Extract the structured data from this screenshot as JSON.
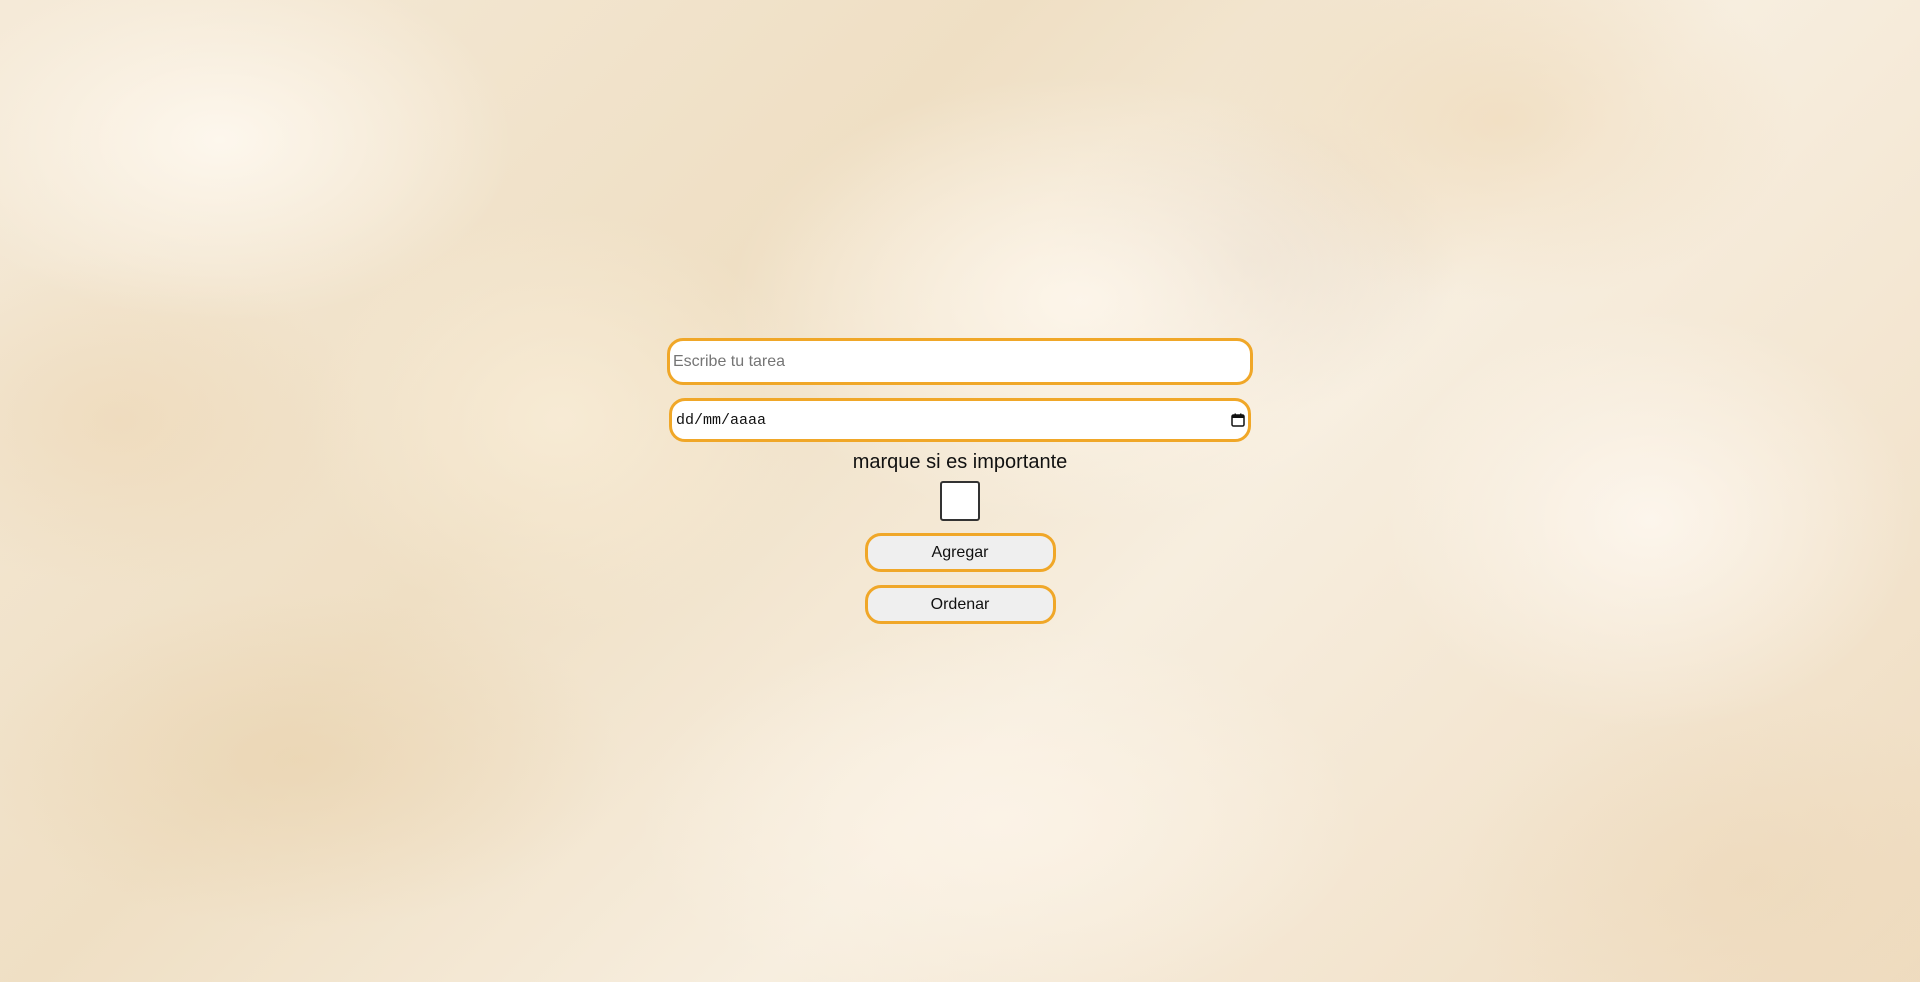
{
  "task_input": {
    "placeholder": "Escribe tu tarea",
    "value": ""
  },
  "date_input": {
    "format_text": "dd/mm/aaaa",
    "icon": "calendar-icon"
  },
  "importance": {
    "label": "marque si es importante",
    "checked": false
  },
  "buttons": {
    "add_label": "Agregar",
    "sort_label": "Ordenar"
  },
  "colors": {
    "accent_border": "#f0a728",
    "button_bg": "#efefef",
    "background": "#f1e4cf"
  }
}
